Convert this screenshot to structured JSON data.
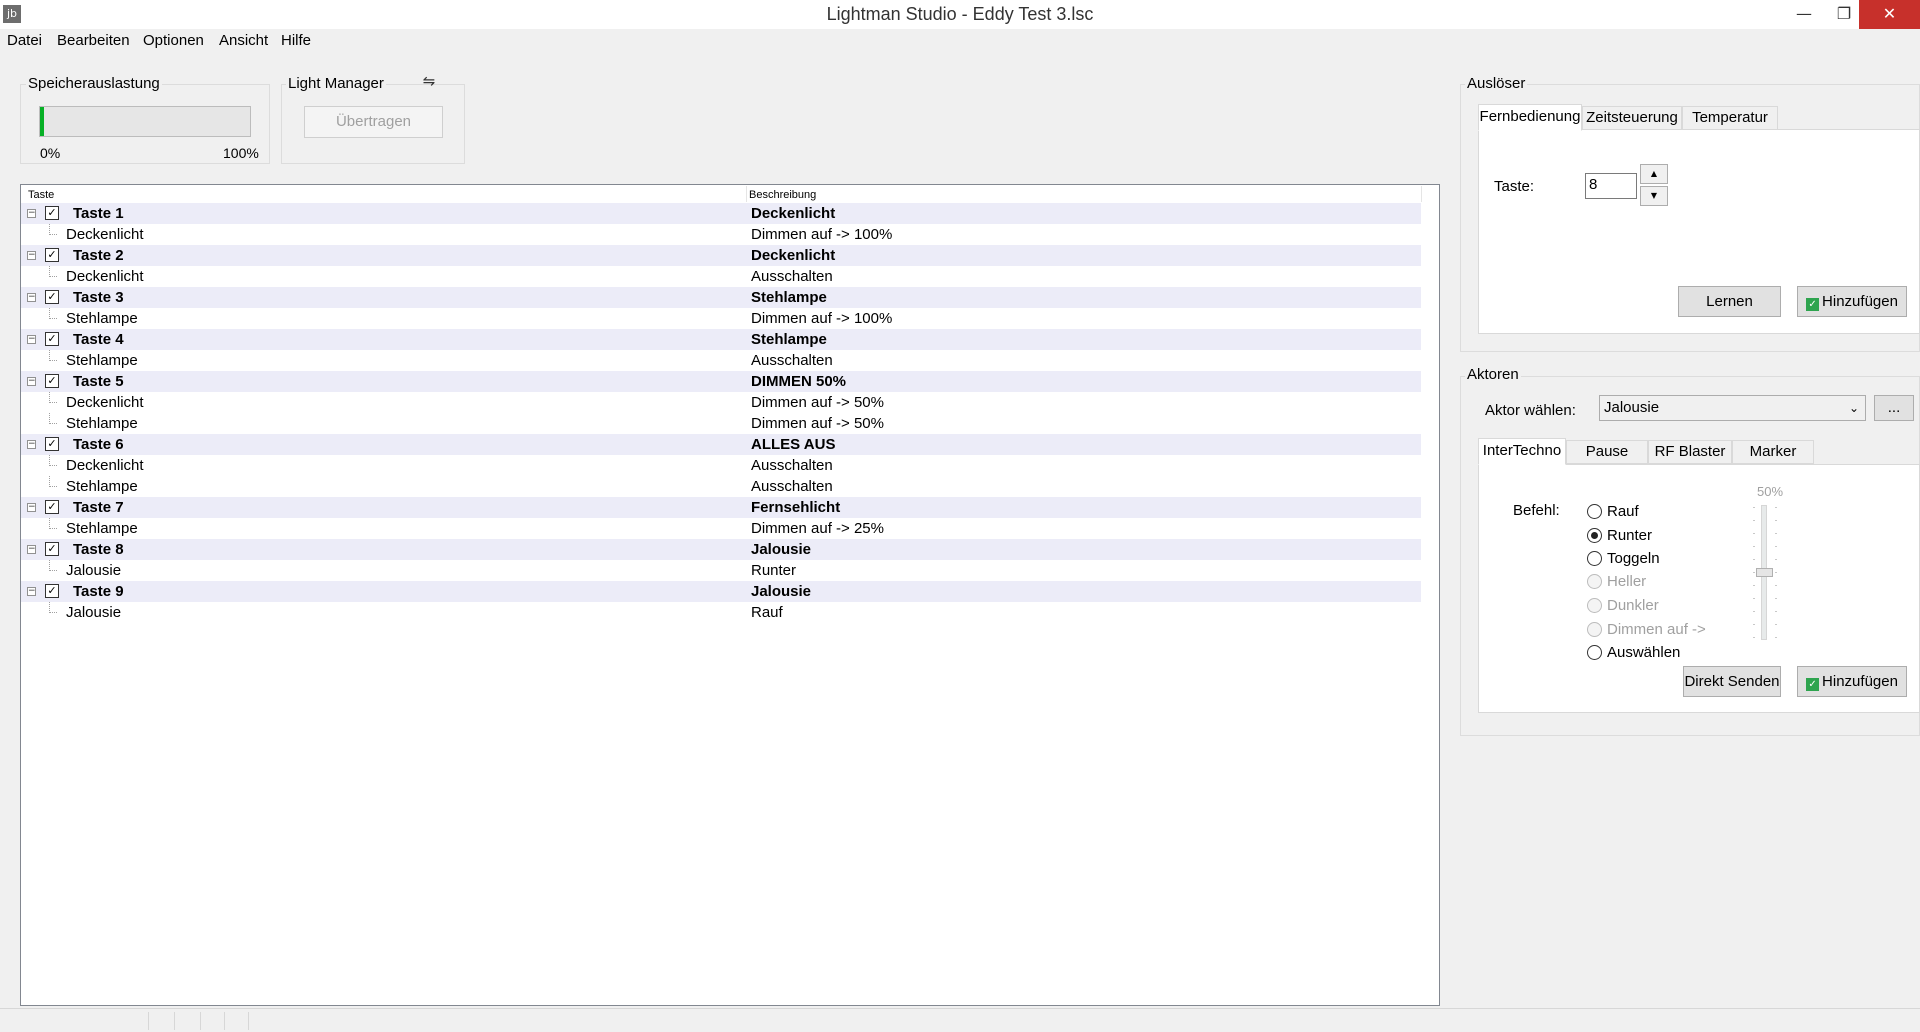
{
  "window": {
    "title": "Lightman Studio - Eddy Test 3.lsc",
    "app_icon": "jb",
    "minimize_glyph": "—",
    "maximize_glyph": "❐",
    "close_glyph": "✕"
  },
  "menu": [
    "Datei",
    "Bearbeiten",
    "Optionen",
    "Ansicht",
    "Hilfe"
  ],
  "memory": {
    "title": "Speicherauslastung",
    "progress_percent": 2,
    "min_label": "0%",
    "max_label": "100%"
  },
  "light_manager": {
    "title": "Light Manager",
    "icon": "usb-icon",
    "transfer_label": "Übertragen"
  },
  "tree": {
    "columns": [
      "Taste",
      "Beschreibung"
    ],
    "rows": [
      {
        "kind": "parent",
        "name": "Taste 1",
        "desc": "Deckenlicht"
      },
      {
        "kind": "child",
        "name": "Deckenlicht",
        "desc": "Dimmen auf -> 100%"
      },
      {
        "kind": "parent",
        "name": "Taste 2",
        "desc": "Deckenlicht"
      },
      {
        "kind": "child",
        "name": "Deckenlicht",
        "desc": "Ausschalten"
      },
      {
        "kind": "parent",
        "name": "Taste 3",
        "desc": "Stehlampe"
      },
      {
        "kind": "child",
        "name": "Stehlampe",
        "desc": "Dimmen auf -> 100%"
      },
      {
        "kind": "parent",
        "name": "Taste 4",
        "desc": "Stehlampe"
      },
      {
        "kind": "child",
        "name": "Stehlampe",
        "desc": "Ausschalten"
      },
      {
        "kind": "parent",
        "name": "Taste 5",
        "desc": "DIMMEN 50%"
      },
      {
        "kind": "child",
        "name": "Deckenlicht",
        "desc": "Dimmen auf -> 50%"
      },
      {
        "kind": "child",
        "name": "Stehlampe",
        "desc": "Dimmen auf -> 50%"
      },
      {
        "kind": "parent",
        "name": "Taste 6",
        "desc": "ALLES AUS"
      },
      {
        "kind": "child",
        "name": "Deckenlicht",
        "desc": "Ausschalten"
      },
      {
        "kind": "child",
        "name": "Stehlampe",
        "desc": "Ausschalten"
      },
      {
        "kind": "parent",
        "name": "Taste 7",
        "desc": "Fernsehlicht"
      },
      {
        "kind": "child",
        "name": "Stehlampe",
        "desc": "Dimmen auf -> 25%"
      },
      {
        "kind": "parent",
        "name": "Taste 8",
        "desc": "Jalousie"
      },
      {
        "kind": "child",
        "name": "Jalousie",
        "desc": "Runter"
      },
      {
        "kind": "parent",
        "name": "Taste 9",
        "desc": "Jalousie"
      },
      {
        "kind": "child",
        "name": "Jalousie",
        "desc": "Rauf"
      }
    ]
  },
  "trigger": {
    "title": "Auslöser",
    "tabs": [
      "Fernbedienung",
      "Zeitsteuerung",
      "Temperatur"
    ],
    "active_tab": 0,
    "key_label": "Taste:",
    "key_value": "8",
    "learn_label": "Lernen",
    "add_label": "Hinzufügen"
  },
  "actors": {
    "title": "Aktoren",
    "select_label": "Aktor wählen:",
    "selected": "Jalousie",
    "browse_label": "...",
    "tabs": [
      "InterTechno",
      "Pause",
      "RF Blaster",
      "Marker"
    ],
    "active_tab": 0,
    "command_label": "Befehl:",
    "commands": [
      {
        "label": "Rauf",
        "checked": false,
        "disabled": false
      },
      {
        "label": "Runter",
        "checked": true,
        "disabled": false
      },
      {
        "label": "Toggeln",
        "checked": false,
        "disabled": false
      },
      {
        "label": "Heller",
        "checked": false,
        "disabled": true
      },
      {
        "label": "Dunkler",
        "checked": false,
        "disabled": true
      },
      {
        "label": "Dimmen auf ->",
        "checked": false,
        "disabled": true
      },
      {
        "label": "Auswählen",
        "checked": false,
        "disabled": false
      }
    ],
    "dim_value": "50%",
    "dim_level_percent": 50,
    "send_label": "Direkt Senden",
    "add_label": "Hinzufügen"
  },
  "colors": {
    "progress_fill": "#06b025",
    "close_button": "#c7302b",
    "parent_row": "#ececf8"
  }
}
